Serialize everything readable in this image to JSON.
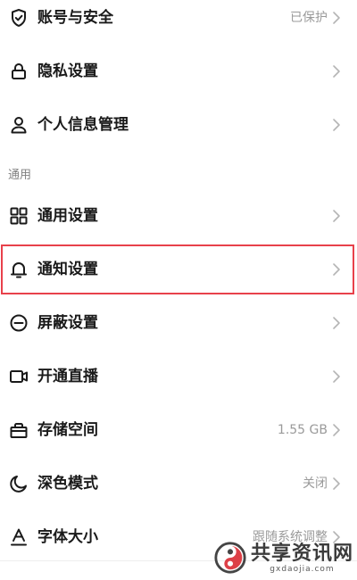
{
  "settings": {
    "items": [
      {
        "label": "账号与安全",
        "value": "已保护",
        "icon": "shield-check-icon"
      },
      {
        "label": "隐私设置",
        "value": "",
        "icon": "lock-icon"
      },
      {
        "label": "个人信息管理",
        "value": "",
        "icon": "person-icon"
      }
    ],
    "section_general": "通用",
    "general_items": [
      {
        "label": "通用设置",
        "value": "",
        "icon": "grid-icon"
      },
      {
        "label": "通知设置",
        "value": "",
        "icon": "bell-icon"
      },
      {
        "label": "屏蔽设置",
        "value": "",
        "icon": "block-icon"
      },
      {
        "label": "开通直播",
        "value": "",
        "icon": "video-icon"
      },
      {
        "label": "存储空间",
        "value": "1.55 GB",
        "icon": "storage-icon"
      },
      {
        "label": "深色模式",
        "value": "关闭",
        "icon": "moon-icon"
      },
      {
        "label": "字体大小",
        "value": "跟随系统调整",
        "icon": "font-size-icon"
      }
    ]
  },
  "highlight_color": "#e8414b",
  "watermark": {
    "cn": "共享资讯网",
    "en": "gxdaojia.com"
  }
}
